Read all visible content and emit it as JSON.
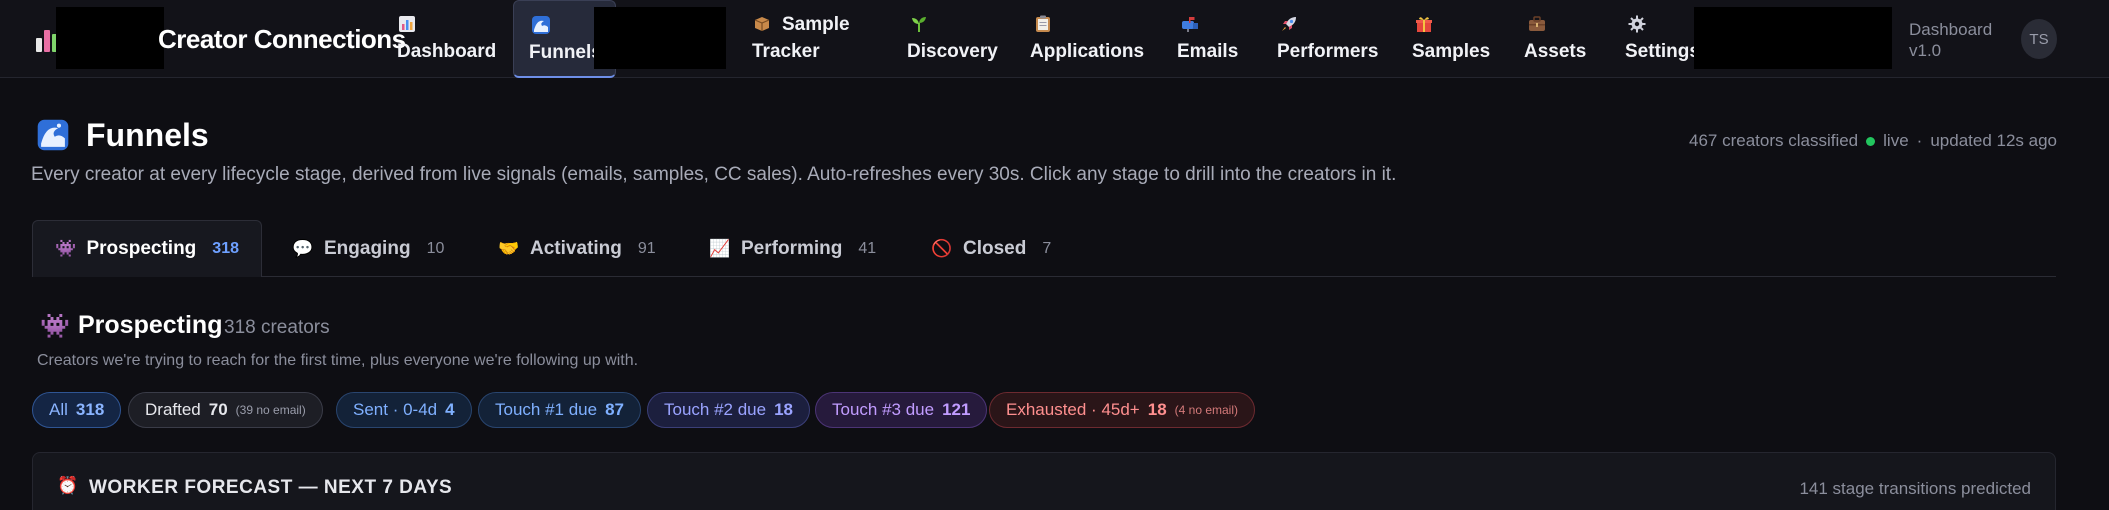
{
  "app": {
    "title": "Creator Connections"
  },
  "nav": {
    "items": [
      {
        "id": "dashboard",
        "label": "Dashboard",
        "icon": "bar-chart-icon"
      },
      {
        "id": "funnels",
        "label": "Funnels",
        "icon": "wave-icon",
        "active": true
      },
      {
        "id": "sample-tracker",
        "label_line1": "Sample",
        "label_line2": "Tracker",
        "icon": "package-icon"
      },
      {
        "id": "discovery",
        "label": "Discovery",
        "icon": "seedling-icon"
      },
      {
        "id": "applications",
        "label": "Applications",
        "icon": "clipboard-icon"
      },
      {
        "id": "emails",
        "label": "Emails",
        "icon": "mailbox-icon"
      },
      {
        "id": "performers",
        "label": "Performers",
        "icon": "rocket-icon"
      },
      {
        "id": "samples",
        "label": "Samples",
        "icon": "gift-icon"
      },
      {
        "id": "assets",
        "label": "Assets",
        "icon": "briefcase-icon"
      },
      {
        "id": "settings",
        "label": "Settings",
        "icon": "gear-icon"
      }
    ],
    "dashboard_version_line1": "Dashboard",
    "dashboard_version_line2": "v1.0",
    "avatar_initials": "TS"
  },
  "page": {
    "title": "Funnels",
    "icon": "wave-icon",
    "creators_classified": "467 creators classified",
    "live_label": "live",
    "separator": "·",
    "updated": "updated 12s ago",
    "subtitle": "Every creator at every lifecycle stage, derived from live signals (emails, samples, CC sales). Auto-refreshes every 30s. Click any stage to drill into the creators in it."
  },
  "tabs": [
    {
      "label": "Prospecting",
      "count": "318",
      "icon": "alien-icon",
      "active": true
    },
    {
      "label": "Engaging",
      "count": "10",
      "icon": "speech-bubble-icon"
    },
    {
      "label": "Activating",
      "count": "91",
      "icon": "handshake-icon"
    },
    {
      "label": "Performing",
      "count": "41",
      "icon": "trend-chart-icon"
    },
    {
      "label": "Closed",
      "count": "7",
      "icon": "no-entry-icon"
    }
  ],
  "stage": {
    "title": "Prospecting",
    "count_text": "318 creators",
    "description": "Creators we're trying to reach for the first time, plus everyone we're following up with."
  },
  "filters": [
    {
      "label": "All",
      "count": "318",
      "note": ""
    },
    {
      "label": "Drafted",
      "count": "70",
      "note": "(39 no email)"
    },
    {
      "label": "Sent · 0-4d",
      "count": "4",
      "note": ""
    },
    {
      "label": "Touch #1 due",
      "count": "87",
      "note": ""
    },
    {
      "label": "Touch #2 due",
      "count": "18",
      "note": ""
    },
    {
      "label": "Touch #3 due",
      "count": "121",
      "note": ""
    },
    {
      "label": "Exhausted · 45d+",
      "count": "18",
      "note": "(4 no email)"
    }
  ],
  "forecast": {
    "title": "WORKER FORECAST — NEXT 7 DAYS",
    "icon": "alarm-clock-icon",
    "meta": "141 stage transitions predicted"
  },
  "colors": {
    "accent": "#6ea0ff",
    "live": "#22c55e",
    "danger": "#ff8f8f"
  }
}
